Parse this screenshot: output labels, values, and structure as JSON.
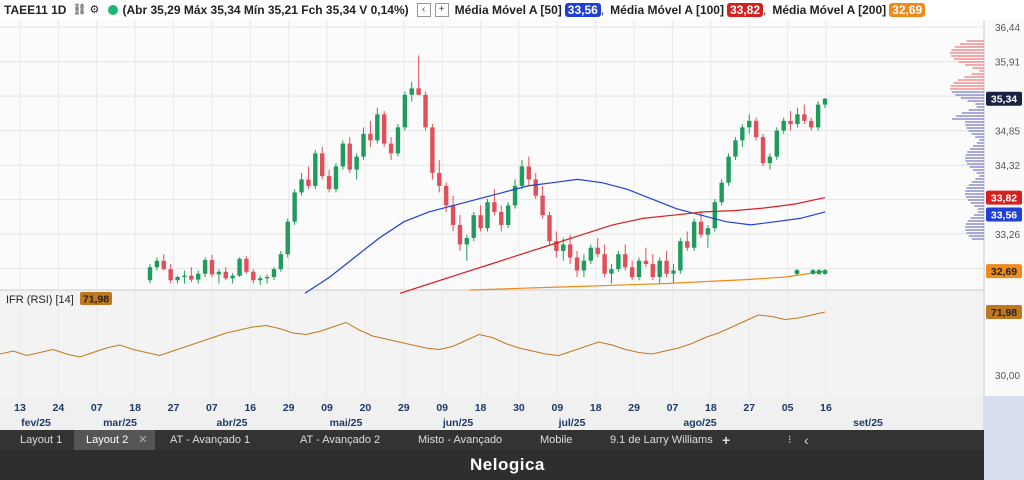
{
  "header": {
    "symbol": "TAEE11 1D",
    "ohlc": "(Abr 35,29 Máx 35,34 Mín 35,21 Fch 35,34 V 0,14%)",
    "ma50_label": "Média Móvel A [50]",
    "ma50_value": "33,56",
    "ma100_label": "Média Móvel A [100]",
    "ma100_value": "33,82",
    "ma200_label": "Média Móvel A [200]",
    "ma200_value": "32,69",
    "ma200_suffix": ""
  },
  "colors": {
    "up": "#1f9c5b",
    "down": "#e0505a",
    "ma50": "#1f3fd6",
    "ma100": "#d62020",
    "ma200": "#f08a1a",
    "rsi": "#c07820",
    "last": "#1b2140"
  },
  "tabs": [
    {
      "label": "Layout 1",
      "active": false
    },
    {
      "label": "Layout 2",
      "active": true,
      "close": "✕"
    },
    {
      "label": "AT - Avançado 1",
      "active": false
    },
    {
      "label": "AT - Avançado 2",
      "active": false
    },
    {
      "label": "Misto - Avançado",
      "active": false
    },
    {
      "label": "Mobile",
      "active": false
    },
    {
      "label": "9.1 de Larry Williams",
      "active": false
    }
  ],
  "tab_add": "+",
  "tab_more": "⁝",
  "tab_back": "‹",
  "brand": "Nelogica",
  "chart_data": {
    "type": "candlestick",
    "price_axis": {
      "min": 32.4,
      "max": 36.55,
      "ticks": [
        "36,44",
        "35,91",
        "35,38",
        "34,85",
        "34,32",
        "33,79",
        "33,26",
        "32,73"
      ]
    },
    "last_price": "35,34",
    "rsi_axis": {
      "ticks": [
        "30,00"
      ]
    },
    "rsi_label": "IFR (RSI) [14]",
    "rsi_value": "71,98",
    "ma_badges": {
      "ma50": "33,56",
      "ma100": "33,82",
      "ma200": "32,69"
    },
    "date_ticks": [
      "13",
      "24",
      "07",
      "18",
      "27",
      "07",
      "16",
      "29",
      "09",
      "20",
      "29",
      "09",
      "18",
      "30",
      "09",
      "18",
      "29",
      "07",
      "18",
      "27",
      "05",
      "16"
    ],
    "month_labels": [
      "fev/25",
      "mar/25",
      "abr/25",
      "mai/25",
      "jun/25",
      "jul/25",
      "ago/25",
      "set/25"
    ],
    "candles": [
      [
        32.55,
        32.8,
        32.5,
        32.75
      ],
      [
        32.75,
        32.9,
        32.7,
        32.85
      ],
      [
        32.85,
        32.95,
        32.7,
        32.72
      ],
      [
        32.72,
        32.8,
        32.5,
        32.55
      ],
      [
        32.55,
        32.62,
        32.5,
        32.6
      ],
      [
        32.6,
        32.7,
        32.5,
        32.62
      ],
      [
        32.62,
        32.75,
        32.52,
        32.56
      ],
      [
        32.56,
        32.7,
        32.5,
        32.65
      ],
      [
        32.65,
        32.9,
        32.6,
        32.86
      ],
      [
        32.86,
        32.94,
        32.6,
        32.64
      ],
      [
        32.64,
        32.72,
        32.5,
        32.68
      ],
      [
        32.68,
        32.75,
        32.55,
        32.58
      ],
      [
        32.58,
        32.66,
        32.5,
        32.62
      ],
      [
        32.62,
        32.9,
        32.6,
        32.88
      ],
      [
        32.88,
        32.92,
        32.65,
        32.68
      ],
      [
        32.68,
        32.72,
        32.5,
        32.55
      ],
      [
        32.55,
        32.62,
        32.48,
        32.58
      ],
      [
        32.58,
        32.64,
        32.5,
        32.6
      ],
      [
        32.6,
        32.75,
        32.55,
        32.72
      ],
      [
        32.72,
        33.0,
        32.68,
        32.95
      ],
      [
        32.95,
        33.5,
        32.9,
        33.45
      ],
      [
        33.45,
        33.95,
        33.4,
        33.9
      ],
      [
        33.9,
        34.2,
        33.85,
        34.1
      ],
      [
        34.1,
        34.3,
        33.95,
        34.0
      ],
      [
        34.0,
        34.55,
        33.95,
        34.5
      ],
      [
        34.5,
        34.6,
        34.1,
        34.15
      ],
      [
        34.15,
        34.25,
        33.9,
        33.95
      ],
      [
        33.95,
        34.35,
        33.9,
        34.3
      ],
      [
        34.3,
        34.7,
        34.25,
        34.65
      ],
      [
        34.65,
        34.75,
        34.2,
        34.25
      ],
      [
        34.25,
        34.5,
        34.1,
        34.45
      ],
      [
        34.45,
        34.9,
        34.4,
        34.8
      ],
      [
        34.8,
        35.0,
        34.6,
        34.7
      ],
      [
        34.7,
        35.2,
        34.65,
        35.1
      ],
      [
        35.1,
        35.15,
        34.6,
        34.65
      ],
      [
        34.65,
        34.75,
        34.4,
        34.5
      ],
      [
        34.5,
        34.95,
        34.45,
        34.9
      ],
      [
        34.9,
        35.45,
        34.85,
        35.4
      ],
      [
        35.4,
        35.6,
        35.3,
        35.5
      ],
      [
        35.5,
        36.0,
        35.45,
        35.4
      ],
      [
        35.4,
        35.45,
        34.85,
        34.9
      ],
      [
        34.9,
        34.95,
        34.1,
        34.2
      ],
      [
        34.2,
        34.4,
        33.9,
        34.0
      ],
      [
        34.0,
        34.05,
        33.6,
        33.7
      ],
      [
        33.7,
        33.85,
        33.3,
        33.4
      ],
      [
        33.4,
        33.55,
        33.0,
        33.1
      ],
      [
        33.1,
        33.25,
        32.85,
        33.2
      ],
      [
        33.2,
        33.6,
        33.15,
        33.55
      ],
      [
        33.55,
        33.7,
        33.3,
        33.35
      ],
      [
        33.35,
        33.8,
        33.3,
        33.75
      ],
      [
        33.75,
        33.95,
        33.55,
        33.6
      ],
      [
        33.6,
        33.7,
        33.3,
        33.4
      ],
      [
        33.4,
        33.75,
        33.35,
        33.7
      ],
      [
        33.7,
        34.1,
        33.65,
        34.0
      ],
      [
        34.0,
        34.4,
        33.95,
        34.3
      ],
      [
        34.3,
        34.45,
        34.0,
        34.1
      ],
      [
        34.1,
        34.2,
        33.8,
        33.85
      ],
      [
        33.85,
        34.0,
        33.5,
        33.55
      ],
      [
        33.55,
        33.6,
        33.1,
        33.15
      ],
      [
        33.15,
        33.3,
        32.9,
        33.0
      ],
      [
        33.0,
        33.2,
        32.85,
        33.1
      ],
      [
        33.1,
        33.25,
        32.8,
        32.9
      ],
      [
        32.9,
        33.0,
        32.6,
        32.7
      ],
      [
        32.7,
        32.95,
        32.6,
        32.85
      ],
      [
        32.85,
        33.1,
        32.8,
        33.05
      ],
      [
        33.05,
        33.2,
        32.9,
        32.95
      ],
      [
        32.95,
        33.1,
        32.6,
        32.65
      ],
      [
        32.65,
        32.8,
        32.5,
        32.72
      ],
      [
        32.72,
        33.0,
        32.68,
        32.95
      ],
      [
        32.95,
        33.1,
        32.7,
        32.75
      ],
      [
        32.75,
        32.85,
        32.55,
        32.6
      ],
      [
        32.6,
        32.9,
        32.55,
        32.85
      ],
      [
        32.85,
        33.05,
        32.75,
        32.8
      ],
      [
        32.8,
        32.95,
        32.55,
        32.6
      ],
      [
        32.6,
        32.9,
        32.5,
        32.85
      ],
      [
        32.85,
        33.0,
        32.6,
        32.65
      ],
      [
        32.65,
        32.8,
        32.5,
        32.7
      ],
      [
        32.7,
        33.2,
        32.65,
        33.15
      ],
      [
        33.15,
        33.3,
        33.0,
        33.05
      ],
      [
        33.05,
        33.5,
        33.0,
        33.45
      ],
      [
        33.45,
        33.6,
        33.2,
        33.25
      ],
      [
        33.25,
        33.4,
        33.05,
        33.35
      ],
      [
        33.35,
        33.8,
        33.3,
        33.75
      ],
      [
        33.75,
        34.1,
        33.7,
        34.05
      ],
      [
        34.05,
        34.5,
        34.0,
        34.45
      ],
      [
        34.45,
        34.75,
        34.4,
        34.7
      ],
      [
        34.7,
        34.95,
        34.6,
        34.9
      ],
      [
        34.9,
        35.1,
        34.8,
        35.0
      ],
      [
        35.0,
        35.05,
        34.7,
        34.75
      ],
      [
        34.75,
        34.8,
        34.3,
        34.35
      ],
      [
        34.35,
        34.5,
        34.25,
        34.45
      ],
      [
        34.45,
        34.9,
        34.4,
        34.85
      ],
      [
        34.85,
        35.05,
        34.8,
        35.0
      ],
      [
        35.0,
        35.15,
        34.85,
        34.95
      ],
      [
        34.95,
        35.2,
        34.9,
        35.1
      ],
      [
        35.1,
        35.25,
        34.95,
        35.0
      ],
      [
        35.0,
        35.05,
        34.85,
        34.9
      ],
      [
        34.9,
        35.3,
        34.85,
        35.25
      ],
      [
        35.25,
        35.35,
        35.2,
        35.34
      ]
    ],
    "ma50_series": [
      32.35,
      32.6,
      32.9,
      33.2,
      33.45,
      33.6,
      33.7,
      33.8,
      33.9,
      34.0,
      34.05,
      34.1,
      34.05,
      33.95,
      33.8,
      33.65,
      33.55,
      33.45,
      33.4,
      33.45,
      33.5,
      33.6
    ],
    "ma100_series": [
      32.35,
      32.5,
      32.65,
      32.8,
      32.95,
      33.1,
      33.25,
      33.4,
      33.5,
      33.55,
      33.6,
      33.62,
      33.66,
      33.72,
      33.82
    ],
    "ma200_series": [
      32.4,
      32.42,
      32.44,
      32.46,
      32.48,
      32.5,
      32.53,
      32.56,
      32.6,
      32.69
    ],
    "rsi_series": [
      44,
      46,
      43,
      45,
      47,
      44,
      42,
      45,
      48,
      50,
      47,
      45,
      43,
      46,
      49,
      52,
      55,
      58,
      60,
      62,
      63,
      61,
      58,
      57,
      59,
      62,
      65,
      60,
      56,
      54,
      52,
      50,
      48,
      47,
      49,
      53,
      57,
      55,
      51,
      48,
      46,
      44,
      43,
      46,
      49,
      52,
      50,
      47,
      45,
      44,
      46,
      48,
      51,
      55,
      58,
      62,
      66,
      70,
      69,
      67,
      68,
      70,
      72
    ]
  }
}
